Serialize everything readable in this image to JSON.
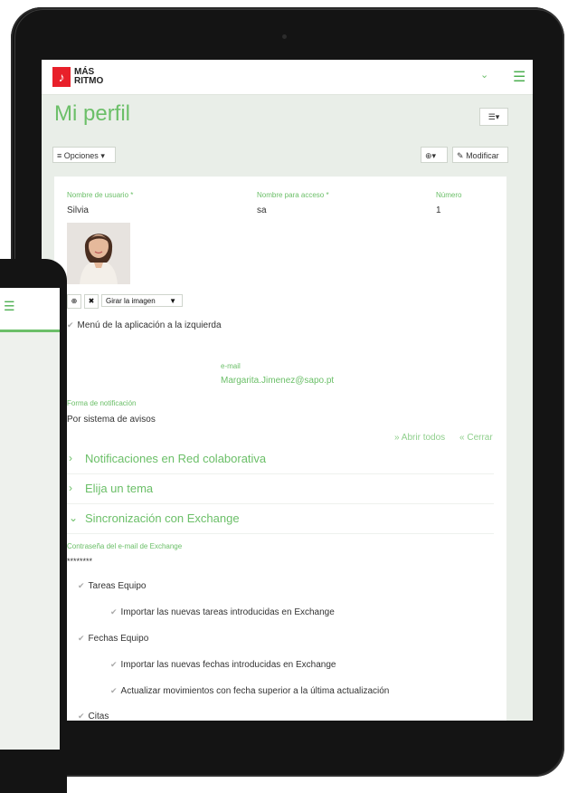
{
  "app": {
    "brand_line1": "MÁS",
    "brand_line2": "RITMO"
  },
  "page": {
    "title": "Mi perfil"
  },
  "toolbar": {
    "options_label": "Opciones",
    "modify_label": "Modificar"
  },
  "profile": {
    "username_label": "Nombre de usuario *",
    "username_value": "Silvia",
    "access_label": "Nombre para acceso *",
    "access_value": "sa",
    "number_label": "Número",
    "number_value": "1",
    "rotate_label": "Girar la imagen",
    "menu_left_label": "Menú de la aplicación a la izquierda",
    "email_label": "e-mail",
    "email_value": "Margarita.Jimenez@sapo.pt",
    "notif_label": "Forma de notificación",
    "notif_value": "Por sistema de avisos"
  },
  "links": {
    "open_all": "Abrir todos",
    "close_all": "Cerrar"
  },
  "sections": [
    {
      "title": "Notificaciones en Red colaborativa"
    },
    {
      "title": "Elija un tema"
    },
    {
      "title": "Sincronización con Exchange"
    }
  ],
  "exchange": {
    "password_label": "Contraseña del e-mail de Exchange",
    "password_value": "********",
    "tasks_label": "Tareas Equipo",
    "import_tasks_label": "Importar las nuevas tareas introducidas en Exchange",
    "dates_label": "Fechas Equipo",
    "import_dates_label": "Importar las nuevas fechas introducidas en Exchange",
    "update_moves_label": "Actualizar movimientos con fecha superior a la última actualización",
    "appointments_label": "Citas"
  },
  "icons": {
    "brand": "music-note-icon",
    "chevron": "chevron-down-icon",
    "menu": "hamburger-icon"
  },
  "colors": {
    "accent": "#6bbf68",
    "brand_red": "#e8202a",
    "screen_bg": "#e9eee8"
  }
}
